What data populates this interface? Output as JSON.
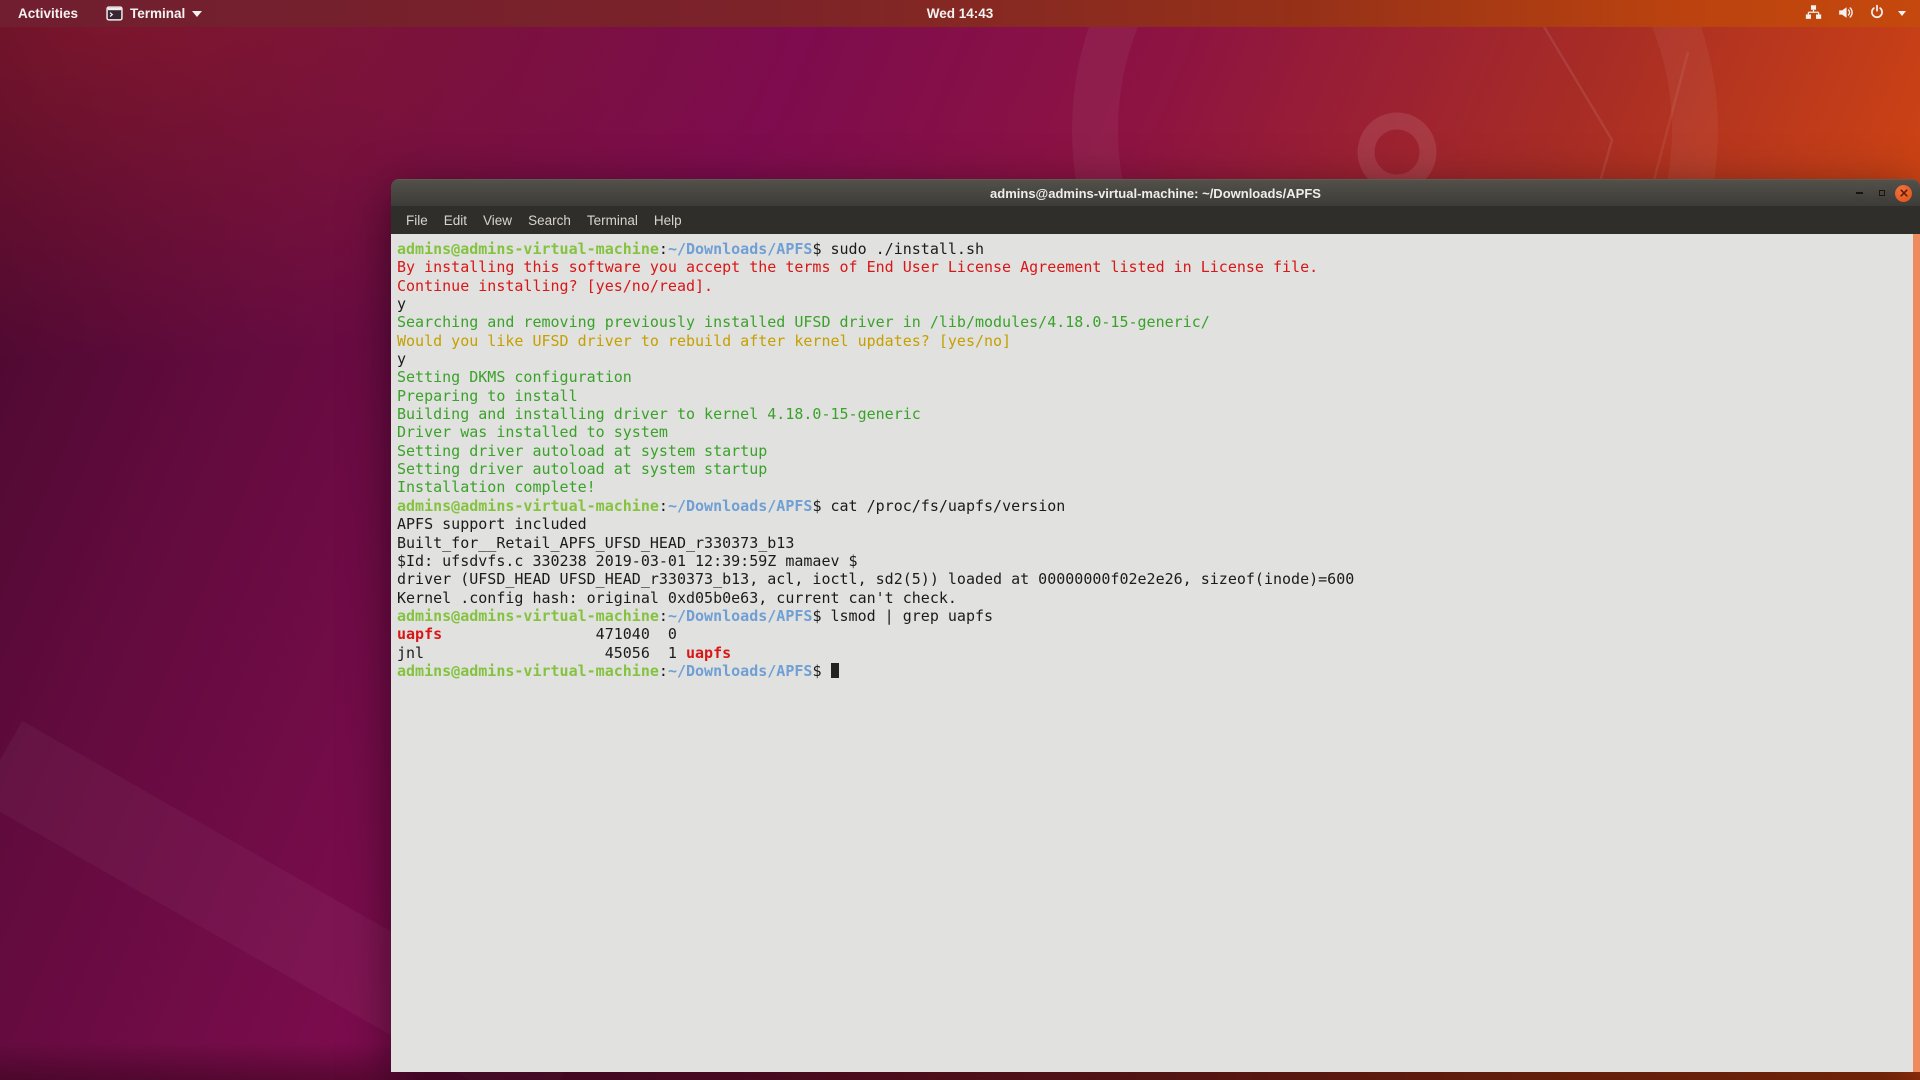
{
  "topbar": {
    "activities_label": "Activities",
    "app_label": "Terminal",
    "clock": "Wed 14:43",
    "icons": {
      "app": "terminal-icon",
      "app_chevron": "chevron-down-icon",
      "network": "network-icon",
      "volume": "volume-icon",
      "power": "power-icon",
      "system_chevron": "chevron-down-icon"
    }
  },
  "window": {
    "title": "admins@admins-virtual-machine: ~/Downloads/APFS",
    "controls": [
      "minimize",
      "maximize",
      "close"
    ],
    "menubar": [
      "File",
      "Edit",
      "View",
      "Search",
      "Terminal",
      "Help"
    ]
  },
  "colors": {
    "desktop_purple": "#7d0c4e",
    "desktop_orange": "#e34a10",
    "terminal_bg": "#e1e1df",
    "prompt_green": "#84c33f",
    "path_blue": "#6f9fd4",
    "message_green": "#3aa22a",
    "warning_yellow": "#c4a000",
    "error_red": "#d81717",
    "close_button_orange": "#e95420",
    "scrollbar_salmon": "#ef8a5e"
  },
  "terminal": {
    "cursor": true,
    "lines": [
      [
        {
          "t": "admins@admins-virtual-machine",
          "c": "user"
        },
        {
          "t": ":",
          "c": "fg"
        },
        {
          "t": "~/Downloads/APFS",
          "c": "path"
        },
        {
          "t": "$ sudo ./install.sh",
          "c": "fg"
        }
      ],
      [
        {
          "t": "By installing this software you accept the terms of End User License Agreement listed in License file.",
          "c": "red"
        }
      ],
      [
        {
          "t": "Continue installing? [yes/no/read].",
          "c": "red"
        }
      ],
      [
        {
          "t": "y",
          "c": "fg"
        }
      ],
      [
        {
          "t": "Searching and removing previously installed UFSD driver in /lib/modules/4.18.0-15-generic/",
          "c": "green"
        }
      ],
      [
        {
          "t": "Would you like UFSD driver to rebuild after kernel updates? [yes/no]",
          "c": "yellow"
        }
      ],
      [
        {
          "t": "y",
          "c": "fg"
        }
      ],
      [
        {
          "t": "Setting DKMS configuration",
          "c": "green"
        }
      ],
      [
        {
          "t": "Preparing to install",
          "c": "green"
        }
      ],
      [
        {
          "t": "Building and installing driver to kernel 4.18.0-15-generic",
          "c": "green"
        }
      ],
      [
        {
          "t": "Driver was installed to system",
          "c": "green"
        }
      ],
      [
        {
          "t": "Setting driver autoload at system startup",
          "c": "green"
        }
      ],
      [
        {
          "t": "Setting driver autoload at system startup",
          "c": "green"
        }
      ],
      [
        {
          "t": "Installation complete!",
          "c": "green"
        }
      ],
      [
        {
          "t": "admins@admins-virtual-machine",
          "c": "user"
        },
        {
          "t": ":",
          "c": "fg"
        },
        {
          "t": "~/Downloads/APFS",
          "c": "path"
        },
        {
          "t": "$ cat /proc/fs/uapfs/version",
          "c": "fg"
        }
      ],
      [
        {
          "t": "APFS support included",
          "c": "fg"
        }
      ],
      [
        {
          "t": "Built_for__Retail_APFS_UFSD_HEAD_r330373_b13",
          "c": "fg"
        }
      ],
      [
        {
          "t": "$Id: ufsdvfs.c 330238 2019-03-01 12:39:59Z mamaev $",
          "c": "fg"
        }
      ],
      [
        {
          "t": "driver (UFSD_HEAD UFSD_HEAD_r330373_b13, acl, ioctl, sd2(5)) loaded at 00000000f02e2e26, sizeof(inode)=600",
          "c": "fg"
        }
      ],
      [
        {
          "t": "Kernel .config hash: original 0xd05b0e63, current can't check.",
          "c": "fg"
        }
      ],
      [
        {
          "t": "admins@admins-virtual-machine",
          "c": "user"
        },
        {
          "t": ":",
          "c": "fg"
        },
        {
          "t": "~/Downloads/APFS",
          "c": "path"
        },
        {
          "t": "$ lsmod | grep uapfs",
          "c": "fg"
        }
      ],
      [
        {
          "t": "uapfs",
          "c": "redb"
        },
        {
          "t": "                 471040  0",
          "c": "fg"
        }
      ],
      [
        {
          "t": "jnl                    45056  1 ",
          "c": "fg"
        },
        {
          "t": "uapfs",
          "c": "redb"
        }
      ],
      [
        {
          "t": "admins@admins-virtual-machine",
          "c": "user"
        },
        {
          "t": ":",
          "c": "fg"
        },
        {
          "t": "~/Downloads/APFS",
          "c": "path"
        },
        {
          "t": "$ ",
          "c": "fg"
        }
      ]
    ]
  }
}
